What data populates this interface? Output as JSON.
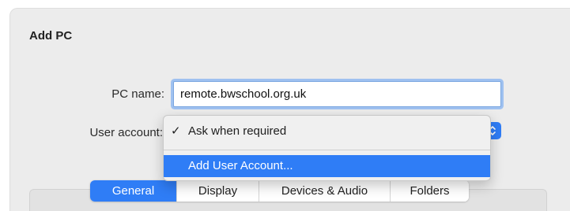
{
  "dialog": {
    "title": "Add PC"
  },
  "form": {
    "pc_name_label": "PC name:",
    "pc_name_value": "remote.bwschool.org.uk",
    "user_account_label": "User account:"
  },
  "user_account_menu": {
    "items": [
      {
        "check": "✓",
        "label": "Ask when required",
        "checked": true
      },
      {
        "check": "",
        "label": "Add User Account...",
        "highlighted": true
      }
    ]
  },
  "tabs": [
    {
      "label": "General",
      "selected": true
    },
    {
      "label": "Display",
      "selected": false
    },
    {
      "label": "Devices & Audio",
      "selected": false
    },
    {
      "label": "Folders",
      "selected": false
    }
  ],
  "colors": {
    "accent": "#2f7df6",
    "sheet_background": "#ececec",
    "focus_ring": "#9fc1f0"
  },
  "icons": {
    "popup_arrows": "up-down-chevron-icon",
    "checkmark": "checkmark-icon"
  }
}
